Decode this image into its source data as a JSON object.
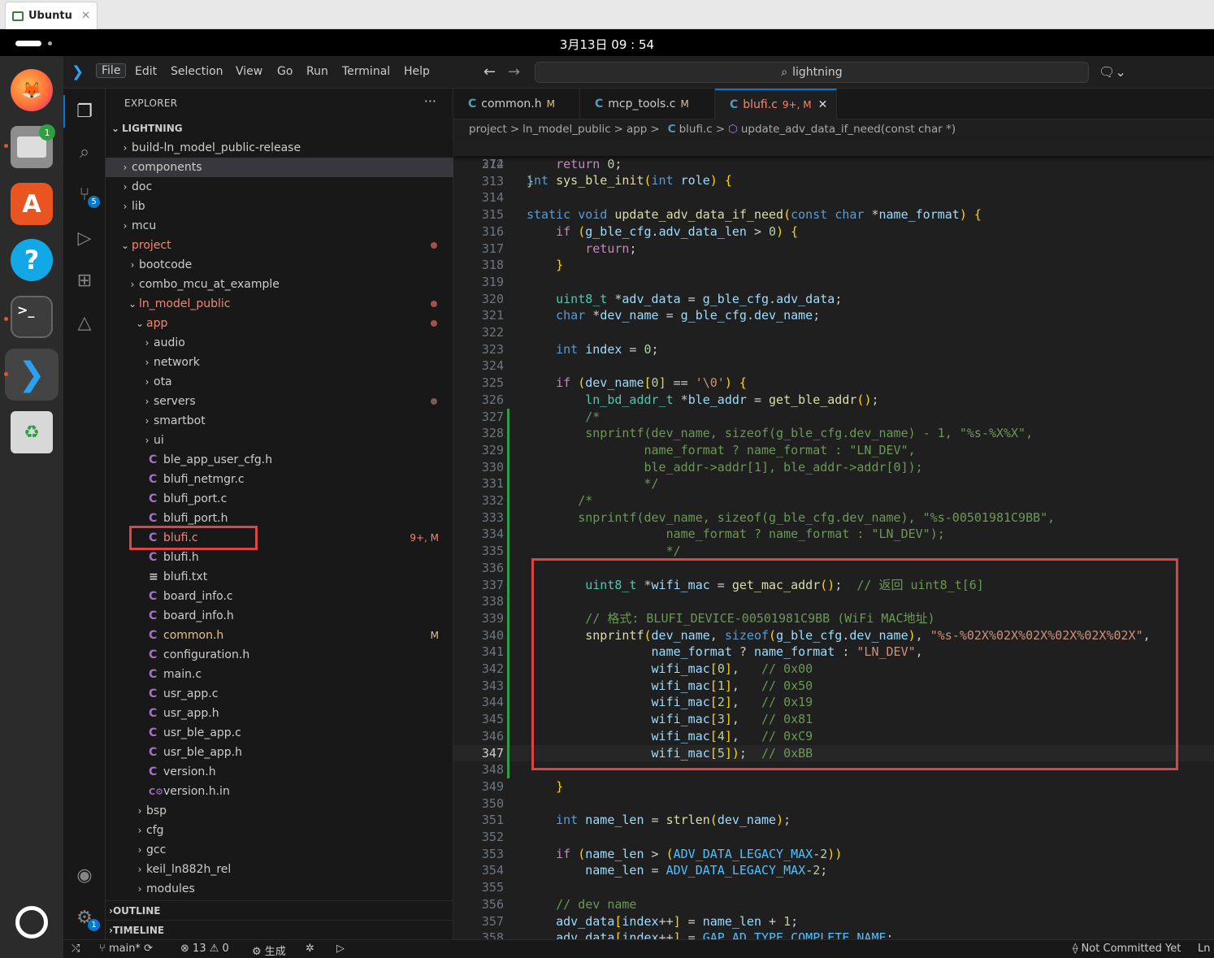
{
  "host": {
    "tab_label": "Ubuntu",
    "close": "✕"
  },
  "topbar": {
    "clock": "3月13日 09 : 54"
  },
  "dock": {
    "files_badge": "1",
    "items": [
      "firefox-icon",
      "files-icon",
      "app-center-icon",
      "help-icon",
      "terminal-icon",
      "vscode-icon",
      "trash-icon",
      "show-apps-icon"
    ]
  },
  "menu": {
    "file": "File",
    "edit": "Edit",
    "selection": "Selection",
    "view": "View",
    "go": "Go",
    "run": "Run",
    "terminal": "Terminal",
    "help": "Help"
  },
  "search": {
    "text": "lightning"
  },
  "activity": {
    "scm_badge": "5",
    "settings_badge": "1"
  },
  "explorer": {
    "title": "EXPLORER",
    "more": "···",
    "root": "LIGHTNING",
    "tree": [
      {
        "label": "build-ln_model_public-release",
        "depth": 0,
        "kind": "folder",
        "open": false
      },
      {
        "label": "components",
        "depth": 0,
        "kind": "folder",
        "open": false,
        "selected": true
      },
      {
        "label": "doc",
        "depth": 0,
        "kind": "folder",
        "open": false
      },
      {
        "label": "lib",
        "depth": 0,
        "kind": "folder",
        "open": false
      },
      {
        "label": "mcu",
        "depth": 0,
        "kind": "folder",
        "open": false
      },
      {
        "label": "project",
        "depth": 0,
        "kind": "folder",
        "open": true,
        "status": "err",
        "dot": true
      },
      {
        "label": "bootcode",
        "depth": 1,
        "kind": "folder",
        "open": false
      },
      {
        "label": "combo_mcu_at_example",
        "depth": 1,
        "kind": "folder",
        "open": false
      },
      {
        "label": "ln_model_public",
        "depth": 1,
        "kind": "folder",
        "open": true,
        "status": "err",
        "dot": true
      },
      {
        "label": "app",
        "depth": 2,
        "kind": "folder",
        "open": true,
        "status": "err",
        "dot": true
      },
      {
        "label": "audio",
        "depth": 3,
        "kind": "folder",
        "open": false
      },
      {
        "label": "network",
        "depth": 3,
        "kind": "folder",
        "open": false
      },
      {
        "label": "ota",
        "depth": 3,
        "kind": "folder",
        "open": false
      },
      {
        "label": "servers",
        "depth": 3,
        "kind": "folder",
        "open": false,
        "dot": true,
        "dotgray": true
      },
      {
        "label": "smartbot",
        "depth": 3,
        "kind": "folder",
        "open": false
      },
      {
        "label": "ui",
        "depth": 3,
        "kind": "folder",
        "open": false
      },
      {
        "label": "ble_app_user_cfg.h",
        "depth": 3,
        "kind": "c"
      },
      {
        "label": "blufi_netmgr.c",
        "depth": 3,
        "kind": "c"
      },
      {
        "label": "blufi_port.c",
        "depth": 3,
        "kind": "c"
      },
      {
        "label": "blufi_port.h",
        "depth": 3,
        "kind": "c"
      },
      {
        "label": "blufi.c",
        "depth": 3,
        "kind": "c",
        "status": "err",
        "badge": "9+, M"
      },
      {
        "label": "blufi.h",
        "depth": 3,
        "kind": "c"
      },
      {
        "label": "blufi.txt",
        "depth": 3,
        "kind": "txt"
      },
      {
        "label": "board_info.c",
        "depth": 3,
        "kind": "c"
      },
      {
        "label": "board_info.h",
        "depth": 3,
        "kind": "c"
      },
      {
        "label": "common.h",
        "depth": 3,
        "kind": "c",
        "status": "mod",
        "badge": "M"
      },
      {
        "label": "configuration.h",
        "depth": 3,
        "kind": "c"
      },
      {
        "label": "main.c",
        "depth": 3,
        "kind": "c"
      },
      {
        "label": "usr_app.c",
        "depth": 3,
        "kind": "c"
      },
      {
        "label": "usr_app.h",
        "depth": 3,
        "kind": "c"
      },
      {
        "label": "usr_ble_app.c",
        "depth": 3,
        "kind": "c"
      },
      {
        "label": "usr_ble_app.h",
        "depth": 3,
        "kind": "c"
      },
      {
        "label": "version.h",
        "depth": 3,
        "kind": "c"
      },
      {
        "label": "version.h.in",
        "depth": 3,
        "kind": "cfg"
      },
      {
        "label": "bsp",
        "depth": 2,
        "kind": "folder",
        "open": false
      },
      {
        "label": "cfg",
        "depth": 2,
        "kind": "folder",
        "open": false
      },
      {
        "label": "gcc",
        "depth": 2,
        "kind": "folder",
        "open": false
      },
      {
        "label": "keil_ln882h_rel",
        "depth": 2,
        "kind": "folder",
        "open": false
      },
      {
        "label": "modules",
        "depth": 2,
        "kind": "folder",
        "open": false
      }
    ],
    "outline": "OUTLINE",
    "timeline": "TIMELINE"
  },
  "tabs": [
    {
      "icon": "C",
      "label": "common.h",
      "status": "M",
      "active": false
    },
    {
      "icon": "C",
      "label": "mcp_tools.c",
      "status": "M",
      "active": false
    },
    {
      "icon": "C",
      "label": "blufi.c",
      "status": "9+, M",
      "active": true
    }
  ],
  "breadcrumb": [
    "project",
    ">",
    "ln_model_public",
    ">",
    "app",
    ">",
    "C",
    "blufi.c",
    ">",
    "⬡",
    "update_adv_data_if_need(const char *)"
  ],
  "sticky": {
    "num": "274",
    "code": "int sys_ble_init(int role) {"
  },
  "colors": {
    "accent": "#e04343",
    "keyword": "#569cd6",
    "type": "#4ec9b0",
    "function": "#dcdcaa",
    "variable": "#9cdcfe",
    "string": "#ce9178",
    "comment": "#6a9955"
  },
  "code": [
    {
      "n": "312",
      "t": "    return 0;"
    },
    {
      "n": "313",
      "t": "}"
    },
    {
      "n": "314",
      "t": ""
    },
    {
      "n": "315",
      "t": "static void update_adv_data_if_need(const char *name_format) {"
    },
    {
      "n": "316",
      "t": "    if (g_ble_cfg.adv_data_len > 0) {"
    },
    {
      "n": "317",
      "t": "        return;"
    },
    {
      "n": "318",
      "t": "    }"
    },
    {
      "n": "319",
      "t": ""
    },
    {
      "n": "320",
      "t": "    uint8_t *adv_data = g_ble_cfg.adv_data;"
    },
    {
      "n": "321",
      "t": "    char *dev_name = g_ble_cfg.dev_name;"
    },
    {
      "n": "322",
      "t": ""
    },
    {
      "n": "323",
      "t": "    int index = 0;"
    },
    {
      "n": "324",
      "t": ""
    },
    {
      "n": "325",
      "t": "    if (dev_name[0] == '\\0') {"
    },
    {
      "n": "326",
      "t": "        ln_bd_addr_t *ble_addr = get_ble_addr();"
    },
    {
      "n": "327",
      "t": "        /*"
    },
    {
      "n": "328",
      "t": "        snprintf(dev_name, sizeof(g_ble_cfg.dev_name) - 1, \"%s-%X%X\","
    },
    {
      "n": "329",
      "t": "                name_format ? name_format : \"LN_DEV\","
    },
    {
      "n": "330",
      "t": "                ble_addr->addr[1], ble_addr->addr[0]);"
    },
    {
      "n": "331",
      "t": "                */"
    },
    {
      "n": "332",
      "t": "       /*"
    },
    {
      "n": "333",
      "t": "       snprintf(dev_name, sizeof(g_ble_cfg.dev_name), \"%s-00501981C9BB\","
    },
    {
      "n": "334",
      "t": "                   name_format ? name_format : \"LN_DEV\");"
    },
    {
      "n": "335",
      "t": "                   */"
    },
    {
      "n": "336",
      "t": ""
    },
    {
      "n": "337",
      "t": "        uint8_t *wifi_mac = get_mac_addr();  // 返回 uint8_t[6]"
    },
    {
      "n": "338",
      "t": ""
    },
    {
      "n": "339",
      "t": "        // 格式: BLUFI_DEVICE-00501981C9BB (WiFi MAC地址)"
    },
    {
      "n": "340",
      "t": "        snprintf(dev_name, sizeof(g_ble_cfg.dev_name), \"%s-%02X%02X%02X%02X%02X%02X\","
    },
    {
      "n": "341",
      "t": "                 name_format ? name_format : \"LN_DEV\","
    },
    {
      "n": "342",
      "t": "                 wifi_mac[0],   // 0x00"
    },
    {
      "n": "343",
      "t": "                 wifi_mac[1],   // 0x50"
    },
    {
      "n": "344",
      "t": "                 wifi_mac[2],   // 0x19"
    },
    {
      "n": "345",
      "t": "                 wifi_mac[3],   // 0x81"
    },
    {
      "n": "346",
      "t": "                 wifi_mac[4],   // 0xC9"
    },
    {
      "n": "347",
      "t": "                 wifi_mac[5]);  // 0xBB"
    },
    {
      "n": "348",
      "t": ""
    },
    {
      "n": "349",
      "t": "    }"
    },
    {
      "n": "350",
      "t": ""
    },
    {
      "n": "351",
      "t": "    int name_len = strlen(dev_name);"
    },
    {
      "n": "352",
      "t": ""
    },
    {
      "n": "353",
      "t": "    if (name_len > (ADV_DATA_LEGACY_MAX-2))"
    },
    {
      "n": "354",
      "t": "        name_len = ADV_DATA_LEGACY_MAX-2;"
    },
    {
      "n": "355",
      "t": ""
    },
    {
      "n": "356",
      "t": "    // dev name"
    },
    {
      "n": "357",
      "t": "    adv_data[index++] = name_len + 1;"
    },
    {
      "n": "358",
      "t": "    adv_data[index++] = GAP_AD_TYPE_COMPLETE_NAME;"
    }
  ],
  "status": {
    "branch": "main*",
    "errors": "13",
    "warnings": "0",
    "build": "生成",
    "commit": "Not Committed Yet",
    "ln": "Ln"
  }
}
